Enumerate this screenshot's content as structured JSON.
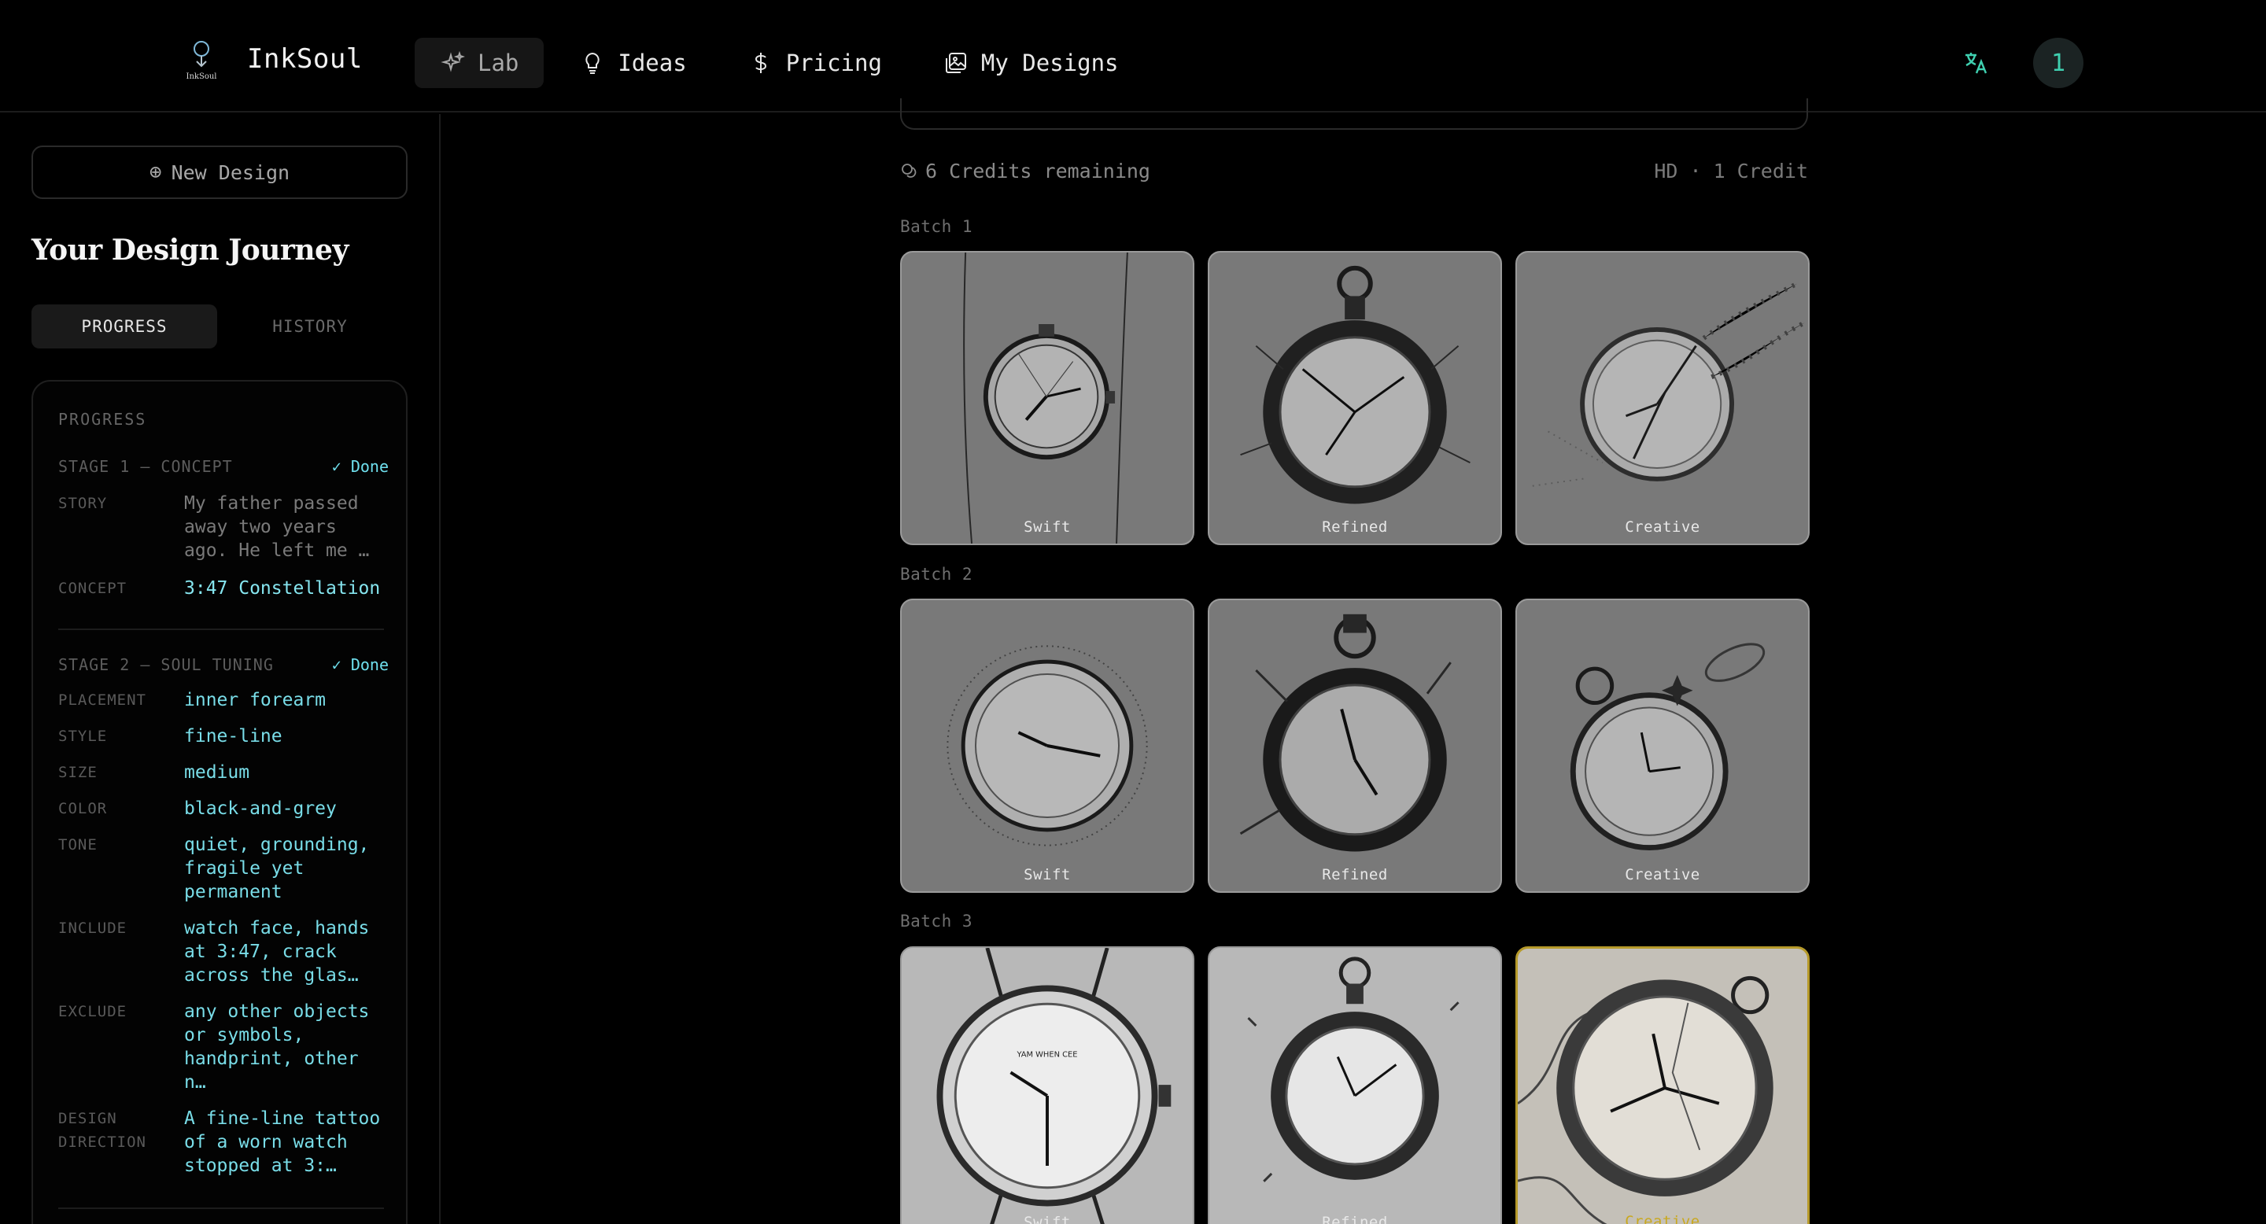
{
  "app": {
    "name": "InkSoul",
    "logo_text": "InkSoul"
  },
  "nav": {
    "items": [
      {
        "label": "Lab",
        "icon": "sparkles-icon",
        "active": true
      },
      {
        "label": "Ideas",
        "icon": "lightbulb-icon",
        "active": false
      },
      {
        "label": "Pricing",
        "icon": "dollar-icon",
        "active": false
      },
      {
        "label": "My Designs",
        "icon": "images-icon",
        "active": false
      }
    ],
    "language_icon": "translate-icon",
    "avatar_text": "1"
  },
  "sidebar": {
    "new_design_label": "New Design",
    "title": "Your Design Journey",
    "tabs": [
      {
        "label": "PROGRESS",
        "active": true
      },
      {
        "label": "HISTORY",
        "active": false
      }
    ],
    "card_label": "PROGRESS",
    "stage1": {
      "name": "STAGE 1 — CONCEPT",
      "status": "✓ Done",
      "story_key": "STORY",
      "story_value": "My father passed away two years ago. He left me …",
      "concept_key": "CONCEPT",
      "concept_value": "3:47 Constellation"
    },
    "stage2": {
      "name": "STAGE 2 — SOUL TUNING",
      "status": "✓ Done",
      "fields": [
        {
          "key": "PLACEMENT",
          "value": "inner forearm"
        },
        {
          "key": "STYLE",
          "value": "fine-line"
        },
        {
          "key": "SIZE",
          "value": "medium"
        },
        {
          "key": "COLOR",
          "value": "black-and-grey"
        },
        {
          "key": "TONE",
          "value": "quiet, grounding, fragile yet permanent"
        },
        {
          "key": "INCLUDE",
          "value": "watch face, hands at 3:47, crack across the glas…"
        },
        {
          "key": "EXCLUDE",
          "value": "any other objects or symbols, handprint, other n…"
        },
        {
          "key": "DESIGN DIRECTION",
          "value": "A fine-line tattoo of a worn watch stopped at 3:…"
        }
      ]
    }
  },
  "main": {
    "credits_text": "6 Credits remaining",
    "quality_text": "HD · 1 Credit",
    "batches": [
      {
        "label": "Batch 1",
        "captions": [
          "Swift",
          "Refined",
          "Creative"
        ]
      },
      {
        "label": "Batch 2",
        "captions": [
          "Swift",
          "Refined",
          "Creative"
        ]
      },
      {
        "label": "Batch 3",
        "captions": [
          "Swift",
          "Refined",
          "Creative"
        ],
        "selected_index": 2,
        "watch_brand_text": "YAM WHEN CEE"
      }
    ]
  }
}
